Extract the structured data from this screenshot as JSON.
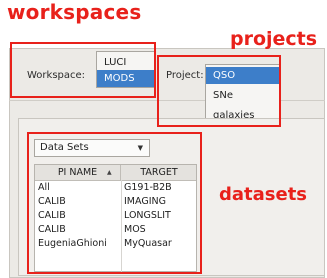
{
  "annotations": {
    "workspaces": "workspaces",
    "projects": "projects",
    "datasets": "datasets"
  },
  "workspace": {
    "label": "Workspace:",
    "options": [
      "LUCI",
      "MODS"
    ],
    "selected": "MODS"
  },
  "project": {
    "label": "Project:",
    "options": [
      "QSO",
      "SNe",
      "galaxies"
    ],
    "selected": "QSO"
  },
  "datasets": {
    "dropdown_value": "Data Sets",
    "columns": [
      "PI NAME",
      "TARGET"
    ],
    "rows": [
      [
        "All",
        "G191-B2B"
      ],
      [
        "CALIB",
        "IMAGING"
      ],
      [
        "CALIB",
        "LONGSLIT"
      ],
      [
        "CALIB",
        "MOS"
      ],
      [
        "EugeniaGhioni",
        "MyQuasar"
      ]
    ]
  },
  "colors": {
    "annotation": "#e8211b",
    "selection": "#3d7ec9",
    "panel": "#eceae6"
  },
  "icons": {
    "dropdown": "chevron-down-icon",
    "sort": "sort-ascending-icon"
  }
}
